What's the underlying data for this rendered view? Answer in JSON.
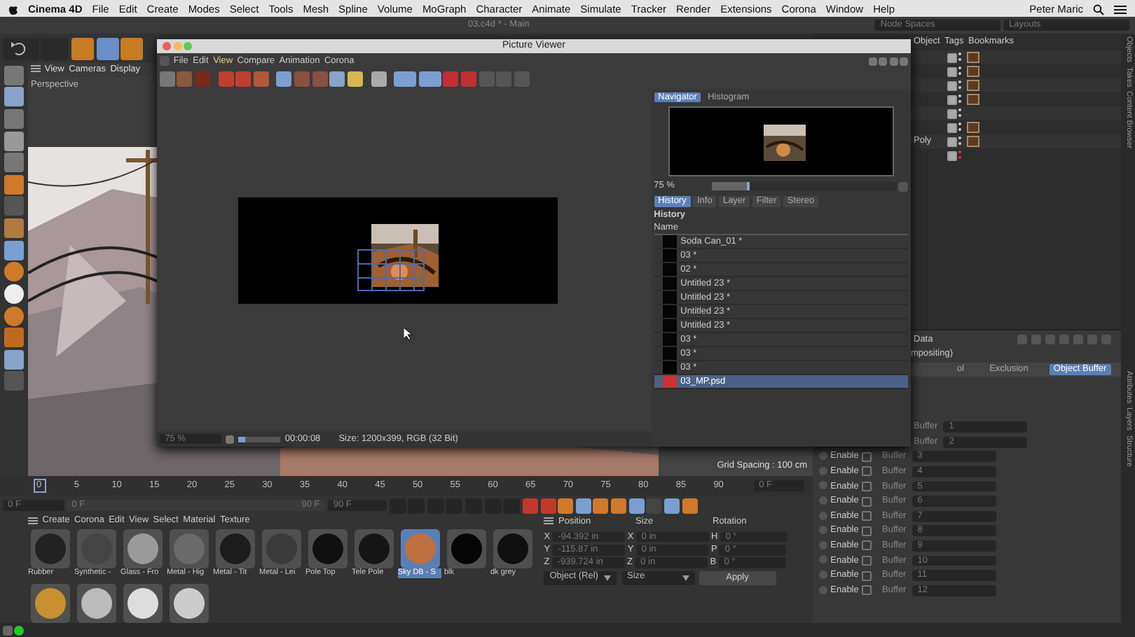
{
  "menubar": {
    "app": "Cinema 4D",
    "items": [
      "File",
      "Edit",
      "Create",
      "Modes",
      "Select",
      "Tools",
      "Mesh",
      "Spline",
      "Volume",
      "MoGraph",
      "Character",
      "Animate",
      "Simulate",
      "Tracker",
      "Render",
      "Extensions",
      "Corona",
      "Window",
      "Help"
    ],
    "user": "Peter Maric"
  },
  "title_bar": {
    "title": "03.c4d * - Main",
    "node_spaces": "Node Spaces",
    "layouts": "Layouts"
  },
  "viewport": {
    "menu": [
      "View",
      "Cameras",
      "Display"
    ],
    "label": "Perspective",
    "grid_spacing": "Grid Spacing : 100 cm"
  },
  "object_manager": {
    "tabs": [
      "Object",
      "Tags",
      "Bookmarks"
    ],
    "rows": [
      {
        "visible": true,
        "tag": true
      },
      {
        "visible": true,
        "tag": true
      },
      {
        "visible": true,
        "tag": true
      },
      {
        "visible": true,
        "tag": true
      },
      {
        "visible": true,
        "tag": false
      },
      {
        "visible": true,
        "tag": true
      },
      {
        "name": "Poly",
        "visible": true,
        "tag": true
      },
      {
        "visible": true,
        "tag": false
      }
    ]
  },
  "side_tabs_top": [
    "Objects",
    "Takes",
    "Content Browser"
  ],
  "side_tabs_bottom": [
    "Attributes",
    "Layers",
    "Structure"
  ],
  "attributes": {
    "title": "Data",
    "subtitle": "mpositing)",
    "tabs": [
      {
        "label": "ol",
        "selected": false
      },
      {
        "label": "Exclusion",
        "selected": false
      },
      {
        "label": "Object Buffer",
        "selected": true
      }
    ],
    "rows": [
      {
        "buffer": "Buffer",
        "value": "1"
      },
      {
        "buffer": "Buffer",
        "value": "2"
      },
      {
        "enable": {
          "label": "Enable",
          "checked": false
        },
        "buffer": "Buffer",
        "value": "3"
      },
      {
        "enable": {
          "label": "Enable",
          "checked": false
        },
        "buffer": "Buffer",
        "value": "4"
      },
      {
        "enable": {
          "label": "Enable",
          "checked": false
        },
        "buffer": "Buffer",
        "value": "5"
      },
      {
        "enable": {
          "label": "Enable",
          "checked": false
        },
        "buffer": "Buffer",
        "value": "6"
      },
      {
        "enable": {
          "label": "Enable",
          "checked": false
        },
        "buffer": "Buffer",
        "value": "7"
      },
      {
        "enable": {
          "label": "Enable",
          "checked": false
        },
        "buffer": "Buffer",
        "value": "8"
      },
      {
        "enable": {
          "label": "Enable",
          "checked": false
        },
        "buffer": "Buffer",
        "value": "9"
      },
      {
        "enable": {
          "label": "Enable",
          "checked": false
        },
        "buffer": "Buffer",
        "value": "10"
      },
      {
        "enable": {
          "label": "Enable",
          "checked": false
        },
        "buffer": "Buffer",
        "value": "11"
      },
      {
        "enable": {
          "label": "Enable",
          "checked": false
        },
        "buffer": "Buffer",
        "value": "12"
      }
    ]
  },
  "timeline": {
    "ticks": [
      "0",
      "5",
      "10",
      "15",
      "20",
      "25",
      "30",
      "35",
      "40",
      "45",
      "50",
      "55",
      "60",
      "65",
      "70",
      "75",
      "80",
      "85",
      "90"
    ],
    "current": "0 F",
    "start": "0 F",
    "range": {
      "start": "0 F",
      "end": "90 F",
      "level": 1
    },
    "end": "90 F"
  },
  "materials": {
    "menu": [
      "Create",
      "Corona",
      "Edit",
      "View",
      "Select",
      "Material",
      "Texture"
    ],
    "items": [
      {
        "name": "Rubber",
        "color": "#222222",
        "selected": false
      },
      {
        "name": "Synthetic -",
        "color": "#444444",
        "selected": false
      },
      {
        "name": "Glass - Fro",
        "color": "#9a9a9a",
        "selected": false
      },
      {
        "name": "Metal - Hig",
        "color": "#6a6a6a",
        "selected": false
      },
      {
        "name": "Metal - Tit",
        "color": "#1c1c1c",
        "selected": false
      },
      {
        "name": "Metal - Lei",
        "color": "#3a3a3a",
        "selected": false
      },
      {
        "name": "Pole Top",
        "color": "#111111",
        "selected": false
      },
      {
        "name": "Tele Pole",
        "color": "#151515",
        "selected": false
      },
      {
        "name": "Sky DB - S",
        "color": "#c07040",
        "selected": true
      },
      {
        "name": "blk",
        "color": "#050505",
        "selected": false
      },
      {
        "name": "dk grey",
        "color": "#101010",
        "selected": false
      },
      {
        "color": "#c89030",
        "selected": false
      },
      {
        "color": "#bbbbbb",
        "selected": false
      },
      {
        "color": "#dddddd",
        "selected": false
      },
      {
        "color": "#cccccc",
        "selected": false
      }
    ]
  },
  "coordinates": {
    "headers": [
      "Position",
      "Size",
      "Rotation"
    ],
    "rows": [
      {
        "axis": "X",
        "position": "-94.392 in",
        "size_axis": "X",
        "size": "0 in",
        "rot_axis": "H",
        "rotation": "0 °"
      },
      {
        "axis": "Y",
        "position": "-115.87 in",
        "size_axis": "Y",
        "size": "0 in",
        "rot_axis": "P",
        "rotation": "0 °"
      },
      {
        "axis": "Z",
        "position": "-939.724 in",
        "size_axis": "Z",
        "size": "0 in",
        "rot_axis": "B",
        "rotation": "0 °"
      }
    ],
    "mode": "Object (Rel)",
    "size_mode": "Size",
    "apply": "Apply"
  },
  "picture_viewer": {
    "title": "Picture Viewer",
    "menu": [
      "File",
      "Edit",
      "View",
      "Compare",
      "Animation",
      "Corona"
    ],
    "zoom": "75 %",
    "time_slider": {
      "level": 0.15
    },
    "time": "00:00:08",
    "info": "Size: 1200x399, RGB (32 Bit)",
    "panel_tabs": [
      {
        "label": "Navigator",
        "selected": true
      },
      {
        "label": "Histogram",
        "selected": false
      }
    ],
    "nav_zoom": "75 %",
    "nav_slider": {
      "level": 0.2
    },
    "tabs": [
      {
        "label": "History",
        "selected": true
      },
      {
        "label": "Info",
        "selected": false
      },
      {
        "label": "Layer",
        "selected": false
      },
      {
        "label": "Filter",
        "selected": false
      },
      {
        "label": "Stereo",
        "selected": false
      }
    ],
    "heading": "History",
    "column": "Name",
    "history": [
      {
        "name": "Soda Can_01 *",
        "selected": false
      },
      {
        "name": "03 *",
        "selected": false
      },
      {
        "name": "02 *",
        "selected": false
      },
      {
        "name": "Untitled 23 *",
        "selected": false
      },
      {
        "name": "Untitled 23 *",
        "selected": false
      },
      {
        "name": "Untitled 23 *",
        "selected": false
      },
      {
        "name": "Untitled 23 *",
        "selected": false
      },
      {
        "name": "03 *",
        "selected": false
      },
      {
        "name": "03 *",
        "selected": false
      },
      {
        "name": "03 *",
        "selected": false
      },
      {
        "name": "03_MP.psd",
        "selected": true
      }
    ]
  }
}
